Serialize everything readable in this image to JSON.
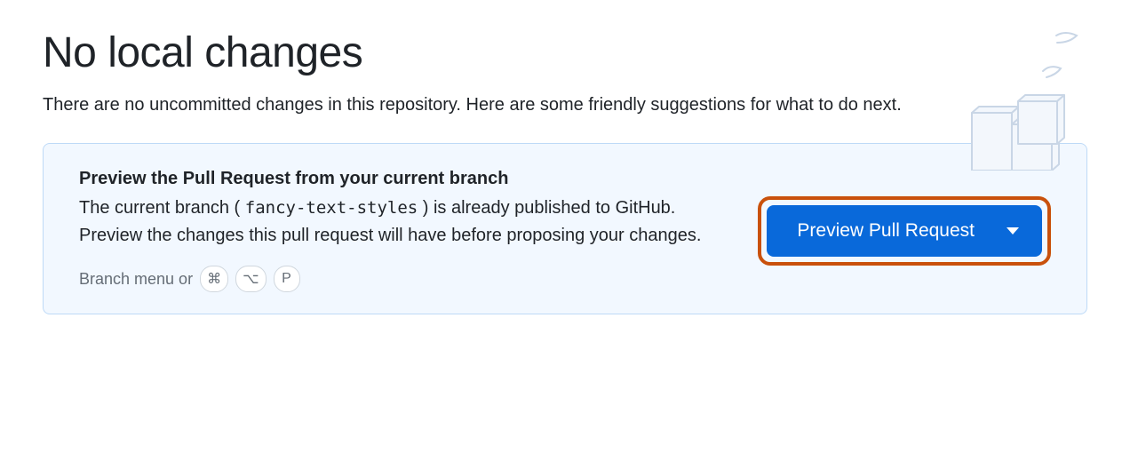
{
  "header": {
    "title": "No local changes",
    "subtitle": "There are no uncommitted changes in this repository. Here are some friendly suggestions for what to do next."
  },
  "panel": {
    "heading": "Preview the Pull Request from your current branch",
    "body_prefix": "The current branch ( ",
    "branch_name": "fancy-text-styles",
    "body_suffix": " ) is already published to GitHub. Preview the changes this pull request will have before proposing your changes.",
    "hint_prefix": "Branch menu or",
    "shortcut_keys": [
      "⌘",
      "⌥",
      "P"
    ],
    "button_label": "Preview Pull Request"
  }
}
